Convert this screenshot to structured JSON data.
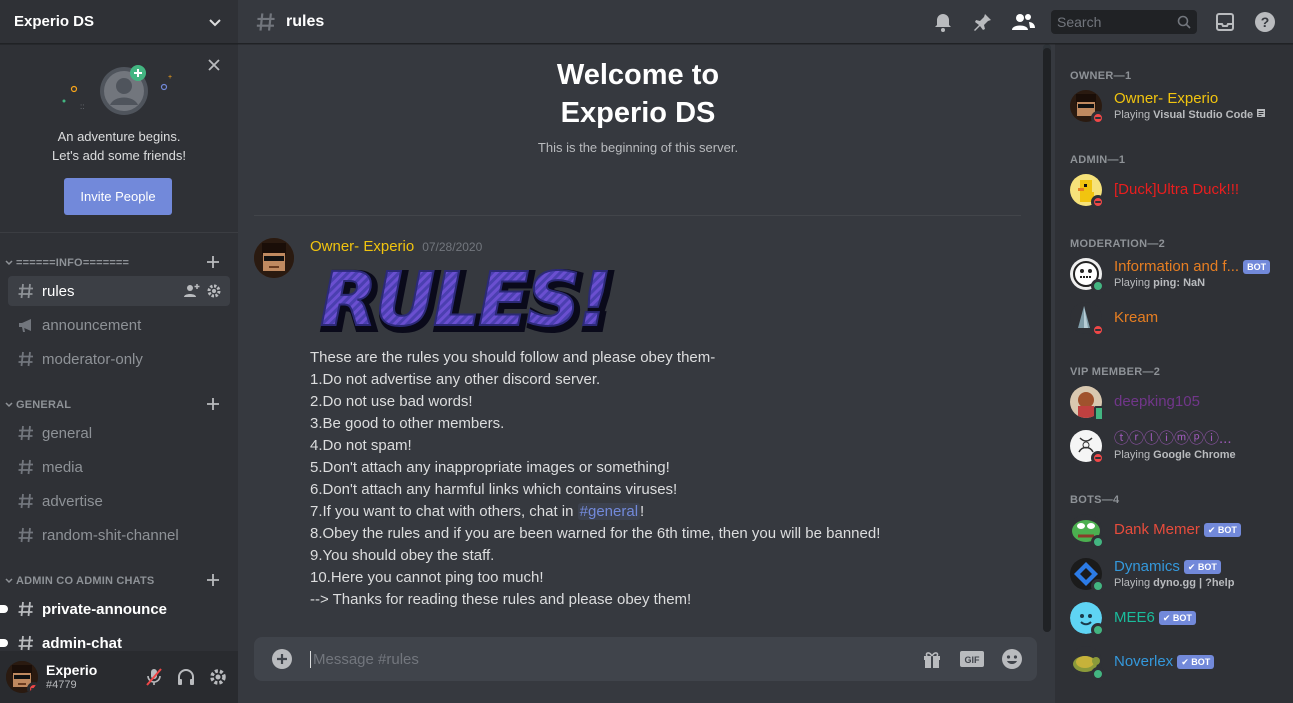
{
  "server": {
    "name": "Experio DS"
  },
  "invite": {
    "line1": "An adventure begins.",
    "line2": "Let's add some friends!",
    "button": "Invite People"
  },
  "categories": [
    {
      "name": "======INFO======="
    },
    {
      "name": "GENERAL"
    },
    {
      "name": "ADMIN CO ADMIN CHATS"
    }
  ],
  "channels": {
    "rules": "rules",
    "announcement": "announcement",
    "moderator_only": "moderator-only",
    "general": "general",
    "media": "media",
    "advertise": "advertise",
    "random": "random-shit-channel",
    "private_announce": "private-announce",
    "admin_chat": "admin-chat"
  },
  "user": {
    "name": "Experio",
    "tag": "#4779"
  },
  "header": {
    "channel": "rules",
    "search_placeholder": "Search"
  },
  "welcome": {
    "line1": "Welcome to",
    "line2": "Experio DS",
    "sub": "This is the beginning of this server."
  },
  "message": {
    "author": "Owner- Experio",
    "time": "07/28/2020",
    "image_text": "RULES!",
    "lines": [
      "These are the rules you should follow and please obey them-",
      "1.Do not advertise any other discord server.",
      "2.Do not use bad words!",
      "3.Be good to other members.",
      "4.Do not spam!",
      "5.Don't attach any inappropriate images or something!",
      "6.Don't attach any harmful links which contains viruses!",
      "8.Obey the rules and if you are been warned for the 6th time, then you will be banned!",
      "9.You should obey the staff.",
      "10.Here you cannot ping too much!",
      "--> Thanks for reading these rules and please obey them!"
    ],
    "line7_pre": "7.If you want to chat with others, chat in ",
    "line7_mention": "#general",
    "line7_post": "!"
  },
  "composer": {
    "placeholder": "Message #rules"
  },
  "members": {
    "groups": [
      "OWNER—1",
      "ADMIN—1",
      "MODERATION—2",
      "VIP MEMBER—2",
      "BOTS—4"
    ],
    "bot_label": "BOT",
    "playing": "Playing ",
    "list": [
      {
        "name": "Owner- Experio",
        "activity": "Visual Studio Code",
        "color": "#f1c40f"
      },
      {
        "name": "[Duck]Ultra Duck!!!",
        "color": "#e91e1e"
      },
      {
        "name": "Information and f...",
        "activity": "ping: NaN",
        "color": "#e67e22"
      },
      {
        "name": "Kream",
        "color": "#e67e22"
      },
      {
        "name": "deepking105",
        "color": "#71368a"
      },
      {
        "name": "ⓣⓡⓛⓘⓜⓟⓘ...",
        "activity": "Google Chrome",
        "color": "#9b59b6"
      },
      {
        "name": "Dank Memer",
        "color": "#e74c3c"
      },
      {
        "name": "Dynamics",
        "activity": "dyno.gg | ?help",
        "color": "#3498db"
      },
      {
        "name": "MEE6",
        "color": "#1abc9c"
      },
      {
        "name": "Noverlex",
        "color": "#3498db"
      }
    ]
  }
}
